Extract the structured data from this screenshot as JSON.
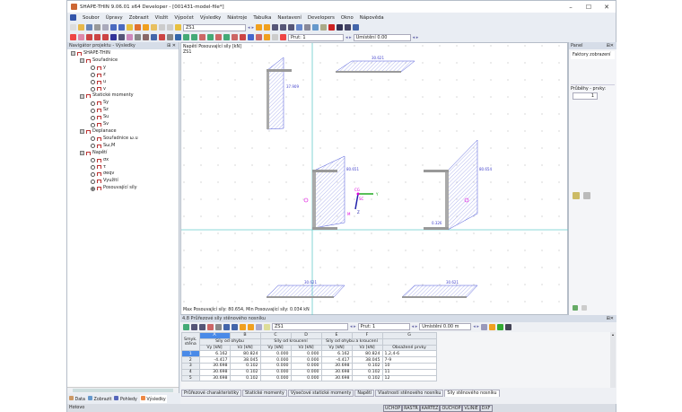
{
  "title": "SHAPE-THIN 9.06.01 x64 Developer - [001431-model-file*]",
  "window_controls": [
    "–",
    "☐",
    "✕"
  ],
  "menu": [
    "Soubor",
    "Úpravy",
    "Zobrazit",
    "Vložit",
    "Výpočet",
    "Výsledky",
    "Nástroje",
    "Tabulka",
    "Nastavení",
    "Developers",
    "Okno",
    "Nápověda"
  ],
  "toolbar": {
    "load_case": "ZS1",
    "member": "Prut: 1",
    "location": "Umístění 0.00"
  },
  "navigator": {
    "title": "Navigátor projektu - Výsledky",
    "root": "SHAPE-THIN",
    "groups": [
      {
        "label": "Souřadnice",
        "items": [
          "y",
          "z",
          "u",
          "v"
        ]
      },
      {
        "label": "Statické momenty",
        "items": [
          "Sy",
          "Sz",
          "Su",
          "Sv"
        ]
      },
      {
        "label": "Deplanace",
        "items": [
          "Souřadnice ω.u",
          "Sω,M"
        ]
      },
      {
        "label": "Napětí",
        "items": [
          "σx",
          "τ",
          "σeqv",
          "Využití",
          "Posouvající síly"
        ]
      }
    ],
    "selected": "Posouvající síly",
    "tabs": [
      "Data",
      "Zobrazit",
      "Pohledy",
      "Výsledky"
    ]
  },
  "graphics": {
    "header": "Napětí Posouvající síly [kN]",
    "load_case": "ZS1",
    "footer": "Max Posouvající síly: 80.654, Min Posouvající síly: 0.034 kN",
    "labels": [
      "37.909",
      "30.621",
      "80.651",
      "80.654",
      "0.326",
      "30.621",
      "30.621",
      "CG",
      "SC",
      "Y",
      "Z",
      "M"
    ],
    "colors": {
      "hatch": "#4a55d8",
      "axis": "#6cc",
      "label": "#d0d"
    }
  },
  "panel": {
    "title": "Panel",
    "section": "Faktory zobrazení",
    "field_label": "Průběhy - prvky:",
    "field_value": "1"
  },
  "table": {
    "title": "4.8 Průřezové síly stěnového nosníku",
    "load_case": "ZS1",
    "member": "Prut: 1",
    "location": "Umístění 0.00 m",
    "col_letters": [
      "A",
      "B",
      "C",
      "D",
      "E",
      "F",
      "G"
    ],
    "row_header": "Smyk. stěna",
    "groups": [
      "Síly od ohybu",
      "Síly od kroucení",
      "Síly od ohybu a kroucení"
    ],
    "subheaders": [
      "Vy [kN]",
      "Vz [kN]",
      "Vy [kN]",
      "Vz [kN]",
      "Vy [kN]",
      "Vz [kN]",
      "Obsažené prvky"
    ],
    "rows": [
      [
        "1",
        "6.162",
        "80.824",
        "0.000",
        "0.000",
        "6.162",
        "80.824",
        "1,2,4-6"
      ],
      [
        "2",
        "-4.417",
        "38.045",
        "0.000",
        "0.000",
        "-4.417",
        "38.045",
        "7-9"
      ],
      [
        "3",
        "30.698",
        "0.102",
        "0.000",
        "0.000",
        "30.698",
        "0.102",
        "10"
      ],
      [
        "4",
        "30.698",
        "0.102",
        "0.000",
        "0.000",
        "30.698",
        "0.102",
        "11"
      ],
      [
        "5",
        "30.698",
        "0.102",
        "0.000",
        "0.000",
        "30.698",
        "0.102",
        "12"
      ]
    ],
    "tabs": [
      "Průřezové charakteristiky",
      "Statické momenty",
      "Výsečové statické momenty",
      "Napětí",
      "Vlastnosti stěnového nosníku",
      "Síly stěnového nosníku"
    ],
    "active_tab": "Síly stěnového nosníku"
  },
  "status": {
    "left": "Hotovo",
    "buttons": [
      "UCHOP",
      "RASTR",
      "KARTEZ",
      "OUCHOP",
      "VLINIE",
      "DXF"
    ]
  }
}
